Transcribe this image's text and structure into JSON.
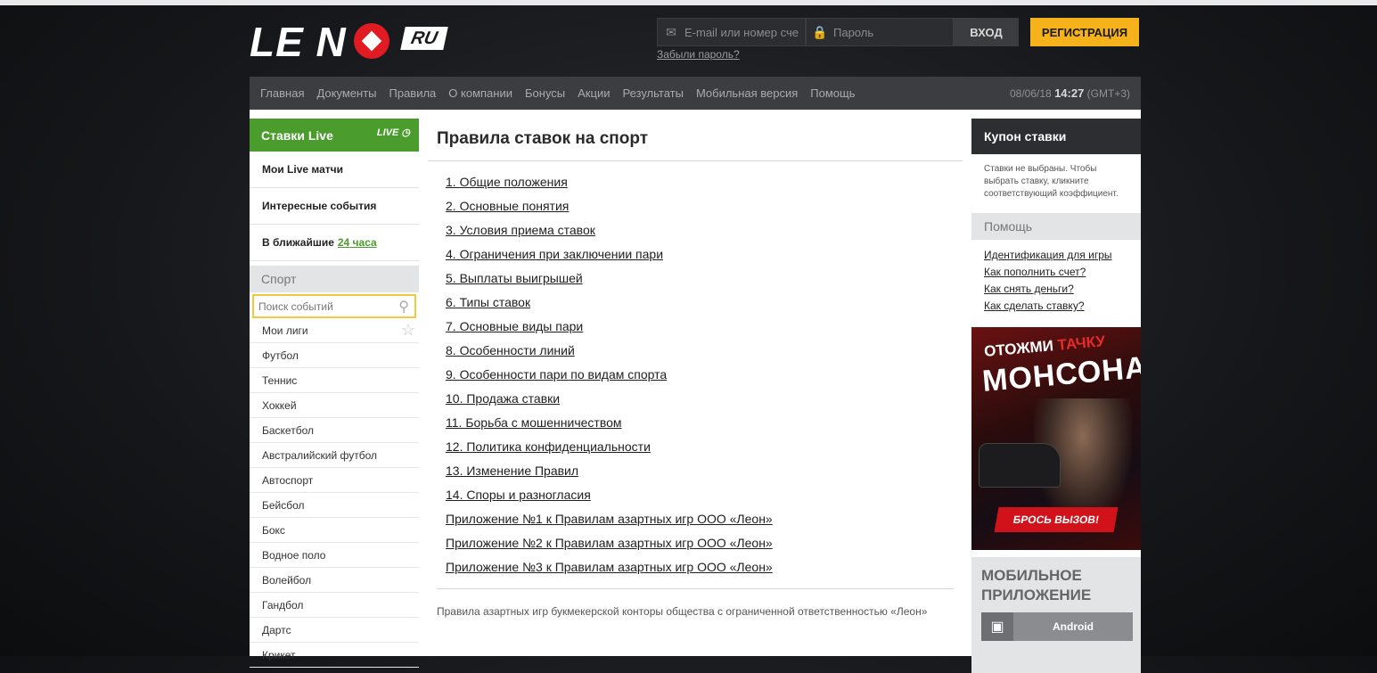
{
  "header": {
    "logo_text": "LE  N",
    "logo_ru": "RU",
    "email_placeholder": "E-mail или номер сче",
    "password_placeholder": "Пароль",
    "login_button": "ВХОД",
    "register_button": "РЕГИСТРАЦИЯ",
    "forgot_password": "Забыли пароль?"
  },
  "nav": {
    "items": [
      "Главная",
      "Документы",
      "Правила",
      "О компании",
      "Бонусы",
      "Акции",
      "Результаты",
      "Мобильная версия",
      "Помощь"
    ],
    "date": "08/06/18",
    "time": "14:27",
    "timezone": "(GMT+3)"
  },
  "left": {
    "live_title": "Ставки Live",
    "live_badge": "LIVE",
    "live_items": [
      "Мои Live матчи",
      "Интересные события"
    ],
    "soon_label": "В ближайшие",
    "soon_link": "24 часа",
    "sport_title": "Спорт",
    "search_placeholder": "Поиск событий",
    "sports": [
      "Мои лиги",
      "Футбол",
      "Теннис",
      "Хоккей",
      "Баскетбол",
      "Австралийский футбол",
      "Автоспорт",
      "Бейсбол",
      "Бокс",
      "Водное поло",
      "Волейбол",
      "Гандбол",
      "Дартс",
      "Крикет"
    ]
  },
  "center": {
    "title": "Правила ставок на спорт",
    "rules": [
      "1. Общие положения",
      "2. Основные понятия",
      "3. Условия приема ставок",
      "4. Ограничения при заключении пари",
      "5. Выплаты выигрышей",
      "6. Типы ставок",
      "7. Основные виды пари",
      "8. Особенности линий",
      "9. Особенности пари по видам спорта",
      "10. Продажа ставки",
      "11. Борьба с мошенничеством",
      "12. Политика конфиденциальности",
      "13. Изменение Правил",
      "14. Споры и разногласия",
      "Приложение №1 к Правилам азартных игр ООО «Леон»",
      "Приложение №2 к Правилам азартных игр ООО «Леон»",
      "Приложение №3 к Правилам азартных игр ООО «Леон»"
    ],
    "footer_text": "Правила азартных игр букмекерской конторы общества с ограниченной ответственностью «Леон»"
  },
  "right": {
    "coupon_title": "Купон ставки",
    "coupon_text": "Ставки не выбраны. Чтобы выбрать ставку, кликните соответствующий коэффициент.",
    "help_title": "Помощь",
    "help_links": [
      "Идентификация для игры",
      "Как пополнить счет?",
      "Как снять деньги?",
      "Как сделать ставку?"
    ],
    "banner_line1_a": "ОТОЖМИ ",
    "banner_line1_b": "ТАЧКУ",
    "banner_line2": "МОНСОНА",
    "banner_cta": "БРОСЬ ВЫЗОВ!",
    "mobile_title_1": "МОБИЛЬНОЕ",
    "mobile_title_2": "ПРИЛОЖЕНИЕ",
    "android_label": "Android"
  },
  "colors": {
    "accent_green": "#4a9d2c",
    "accent_yellow": "#f5b21a",
    "brand_red": "#e11b22"
  }
}
